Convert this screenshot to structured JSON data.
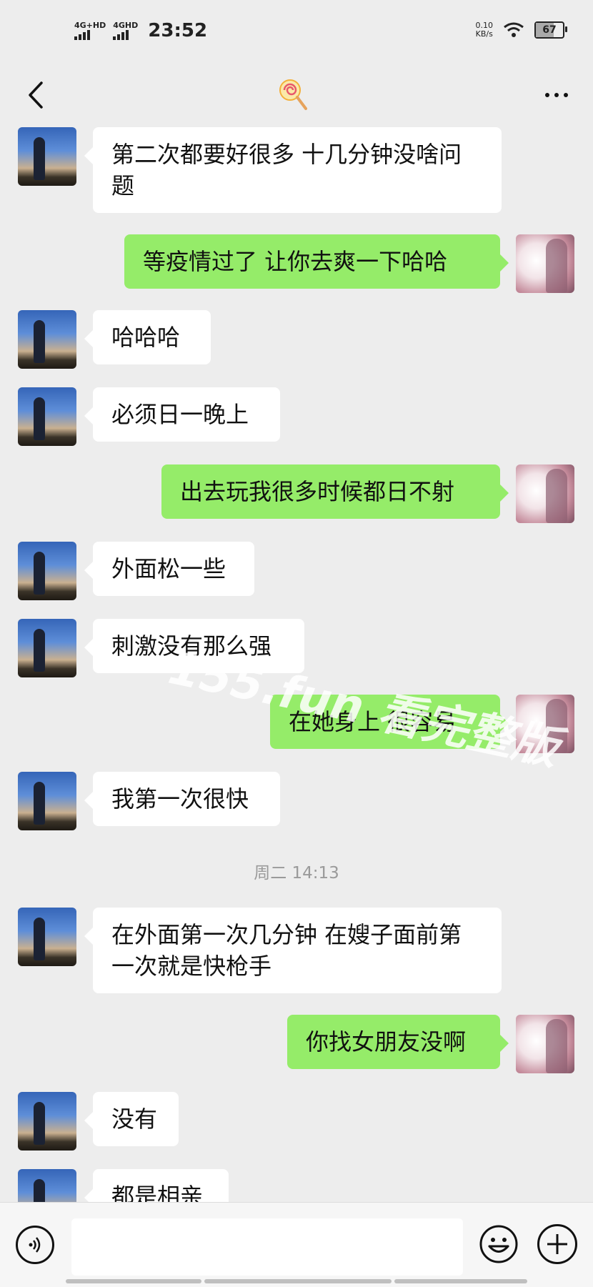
{
  "status_bar": {
    "network1": "4G+HD",
    "network2": "4GHD",
    "time": "23:52",
    "speed_value": "0.10",
    "speed_unit": "KB/s",
    "battery": "67",
    "battery_level": 0.67
  },
  "nav": {
    "back_icon": "chevron-left-icon",
    "title_icon": "lollipop-icon",
    "more_icon": "more-dots-icon"
  },
  "messages": [
    {
      "side": "in",
      "text": "第二次都要好很多 十几分钟没啥问题"
    },
    {
      "side": "out",
      "text": "等疫情过了  让你去爽一下哈哈"
    },
    {
      "side": "in",
      "text": "哈哈哈"
    },
    {
      "side": "in",
      "text": "必须日一晚上"
    },
    {
      "side": "out",
      "text": "出去玩我很多时候都日不射"
    },
    {
      "side": "in",
      "text": "外面松一些"
    },
    {
      "side": "in",
      "text": "刺激没有那么强"
    },
    {
      "side": "out",
      "text": "在她身上   很容易"
    },
    {
      "side": "in",
      "text": "我第一次很快"
    },
    {
      "side": "time",
      "text": "周二 14:13"
    },
    {
      "side": "in",
      "text": "在外面第一次几分钟 在嫂子面前第一次就是快枪手"
    },
    {
      "side": "out",
      "text": "你找女朋友没啊"
    },
    {
      "side": "in",
      "text": "没有"
    },
    {
      "side": "in",
      "text": "都是相亲"
    }
  ],
  "watermark": "155.fun 看完整版",
  "input_bar": {
    "voice_icon": "voice-icon",
    "input_value": "",
    "emoji_icon": "emoji-icon",
    "plus_icon": "plus-icon"
  }
}
